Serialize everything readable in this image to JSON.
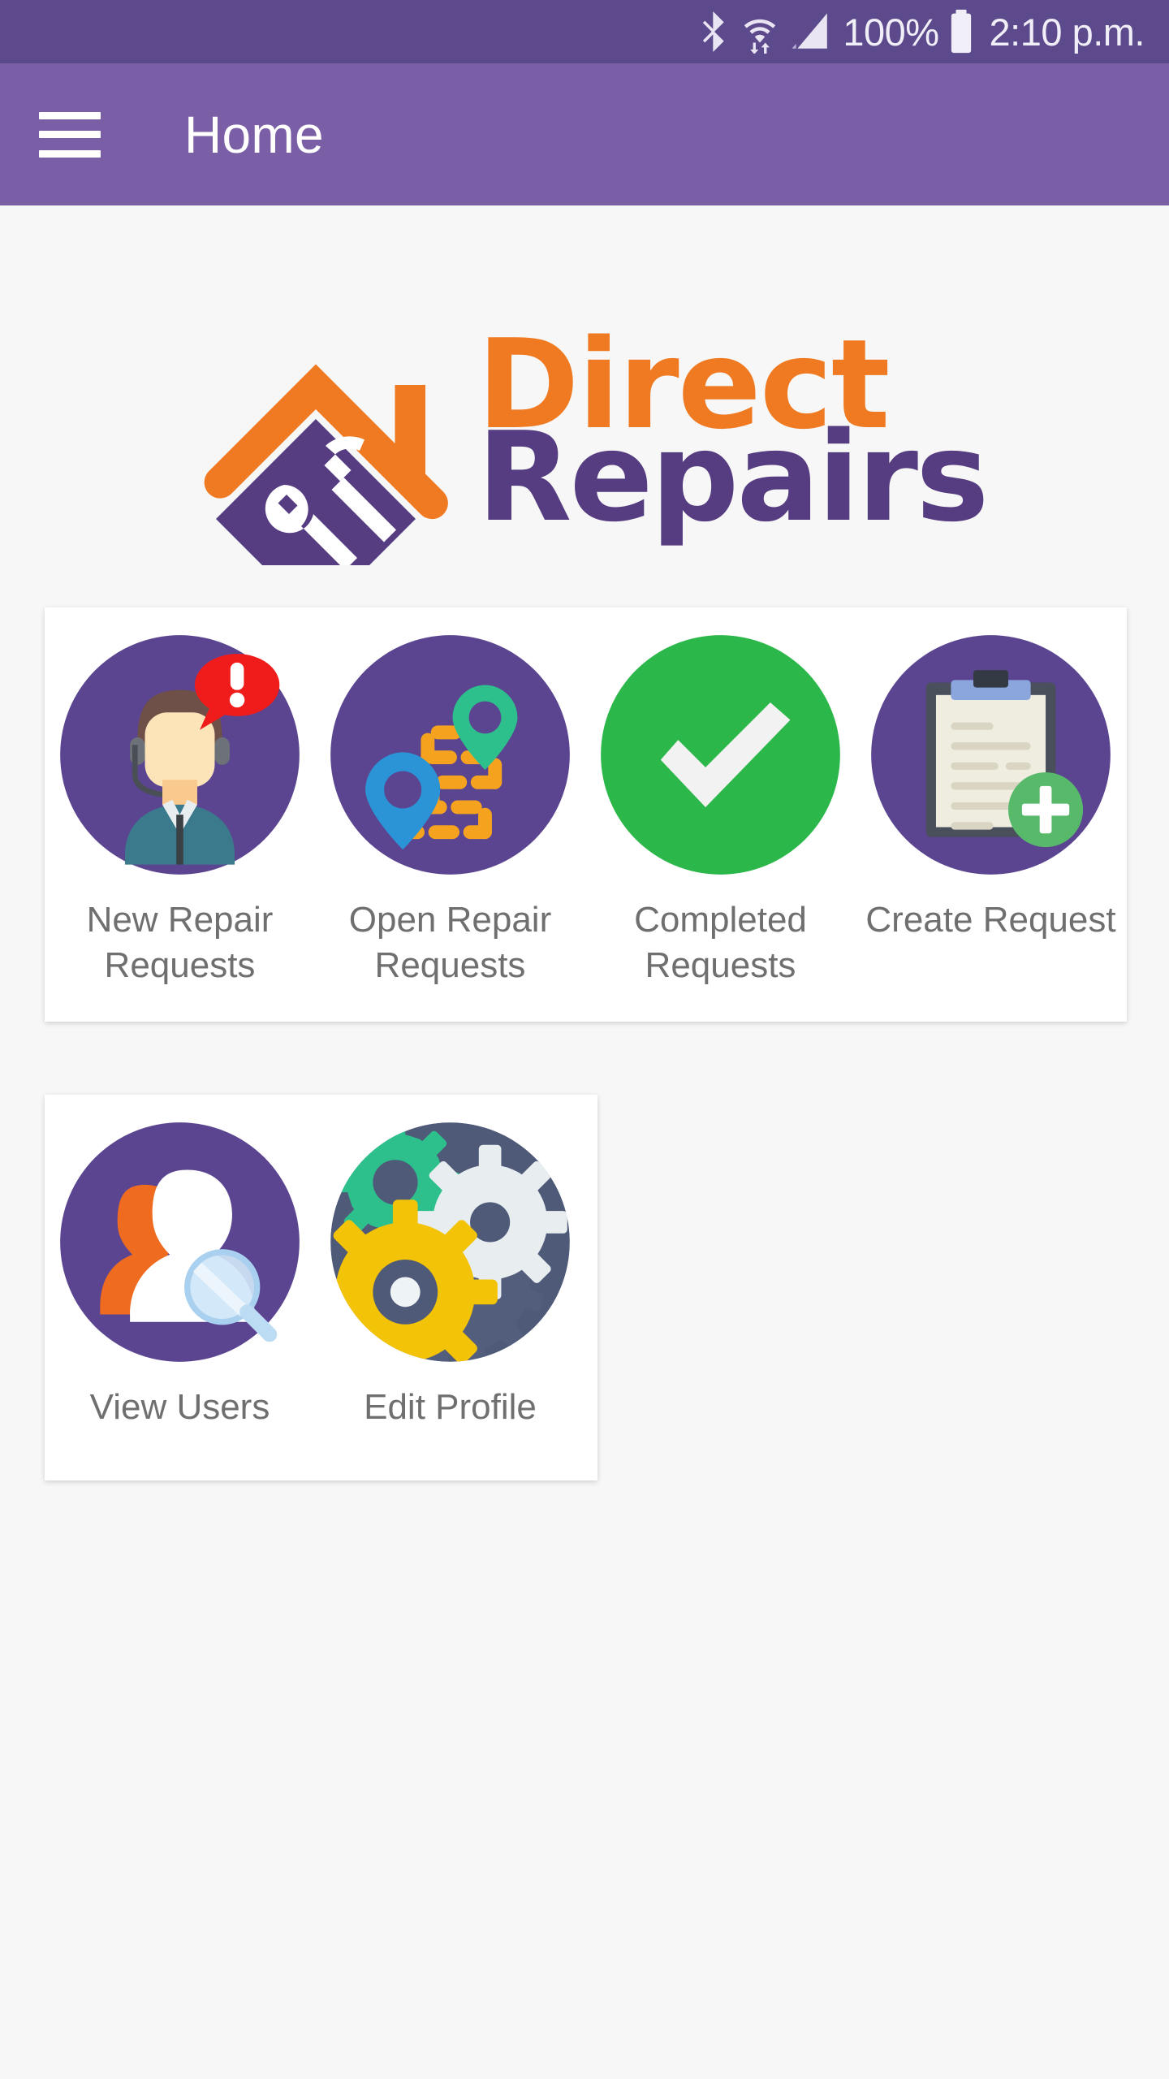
{
  "status_bar": {
    "bluetooth_icon": "bluetooth-icon",
    "wifi_icon": "wifi-icon",
    "signal_icon": "signal-bars-icon",
    "battery_percent": "100%",
    "battery_icon": "battery-full-icon",
    "time": "2:10 p.m."
  },
  "app_bar": {
    "menu_icon": "hamburger-menu-icon",
    "title": "Home"
  },
  "logo": {
    "mark_icon": "house-hammer-wrench-logo-icon",
    "word_1": "Direct",
    "word_2": "Repairs",
    "orange": "#f07a22",
    "purple": "#563d82"
  },
  "colors": {
    "status_bar": "#5d4a8c",
    "app_bar": "#7a5fa6",
    "page_background": "#f7f7f7",
    "card_background": "#ffffff",
    "tile_circle_purple": "#5b4591",
    "accent_green": "#2bb749",
    "label_text": "#6f6f6f"
  },
  "cards": [
    {
      "name": "primary-actions-card",
      "tiles": [
        {
          "icon": "support-agent-alert-icon",
          "label": "New Repair\nRequests",
          "label_line_1": "New Repair",
          "label_line_2": "Requests"
        },
        {
          "icon": "route-map-pins-icon",
          "label": "Open Repair\nRequests",
          "label_line_1": "Open Repair",
          "label_line_2": "Requests"
        },
        {
          "icon": "green-checkmark-icon",
          "label": "Completed\nRequests",
          "label_line_1": "Completed",
          "label_line_2": "Requests"
        },
        {
          "icon": "clipboard-plus-icon",
          "label": "Create Request",
          "label_line_1": "Create Request",
          "label_line_2": ""
        }
      ]
    },
    {
      "name": "account-actions-card",
      "tiles": [
        {
          "icon": "users-magnifier-icon",
          "label": "View Users",
          "label_line_1": "View Users",
          "label_line_2": ""
        },
        {
          "icon": "gears-settings-icon",
          "label": "Edit Profile",
          "label_line_1": "Edit Profile",
          "label_line_2": ""
        }
      ]
    }
  ]
}
